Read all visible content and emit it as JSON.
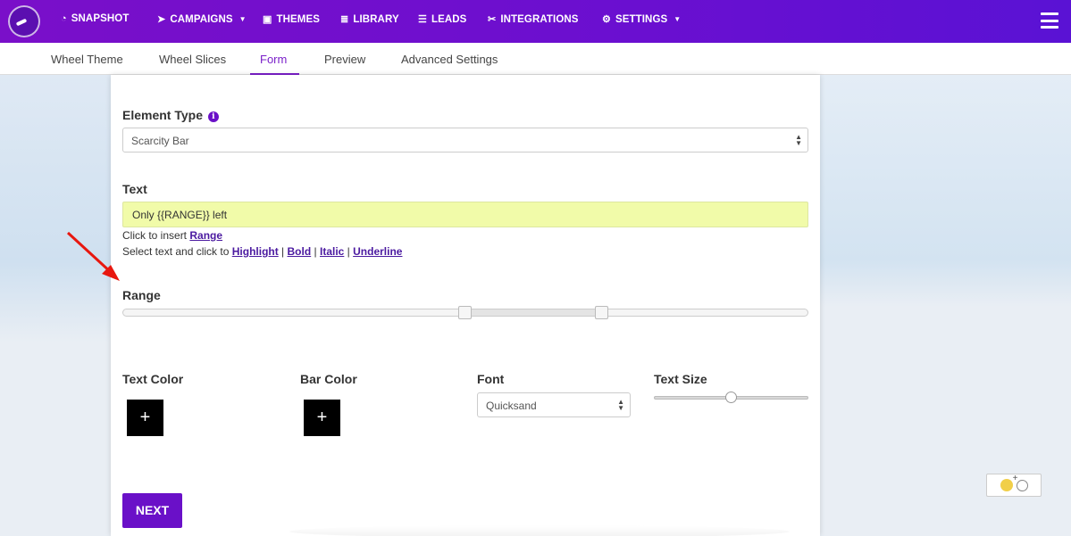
{
  "nav": {
    "items": [
      {
        "label": "SNAPSHOT",
        "icon": "dashboard-icon",
        "glyph": "◔"
      },
      {
        "label": "CAMPAIGNS",
        "icon": "paper-plane-icon",
        "glyph": "➤",
        "dropdown": true
      },
      {
        "label": "THEMES",
        "icon": "image-icon",
        "glyph": "▣"
      },
      {
        "label": "LIBRARY",
        "icon": "list-icon",
        "glyph": "≣"
      },
      {
        "label": "LEADS",
        "icon": "list-alt-icon",
        "glyph": "☰"
      },
      {
        "label": "INTEGRATIONS",
        "icon": "plug-icon",
        "glyph": "✂"
      },
      {
        "label": "SETTINGS",
        "icon": "cogs-icon",
        "glyph": "⚙",
        "dropdown": true
      }
    ]
  },
  "tabs": [
    {
      "label": "Wheel Theme",
      "active": false
    },
    {
      "label": "Wheel Slices",
      "active": false
    },
    {
      "label": "Form",
      "active": true
    },
    {
      "label": "Preview",
      "active": false
    },
    {
      "label": "Advanced Settings",
      "active": false
    }
  ],
  "form": {
    "element_type_label": "Element Type",
    "element_type_value": "Scarcity Bar",
    "text_label": "Text",
    "text_value": "Only  {{RANGE}} left",
    "helper_insert_prefix": "Click to insert",
    "helper_insert_link": "Range",
    "helper_format_prefix": "Select text and click to",
    "helper_highlight": "Highlight",
    "helper_bold": "Bold",
    "helper_italic": "Italic",
    "helper_underline": "Underline",
    "range_label": "Range",
    "text_color_label": "Text Color",
    "bar_color_label": "Bar Color",
    "font_label": "Font",
    "font_value": "Quicksand",
    "text_size_label": "Text Size",
    "plus_glyph": "+",
    "next_label": "NEXT"
  },
  "colors": {
    "nav_bg": "#6a10c8",
    "accent": "#7a1fc9",
    "text_input_bg": "#f1fba9",
    "annotation_arrow": "#e8170f"
  }
}
